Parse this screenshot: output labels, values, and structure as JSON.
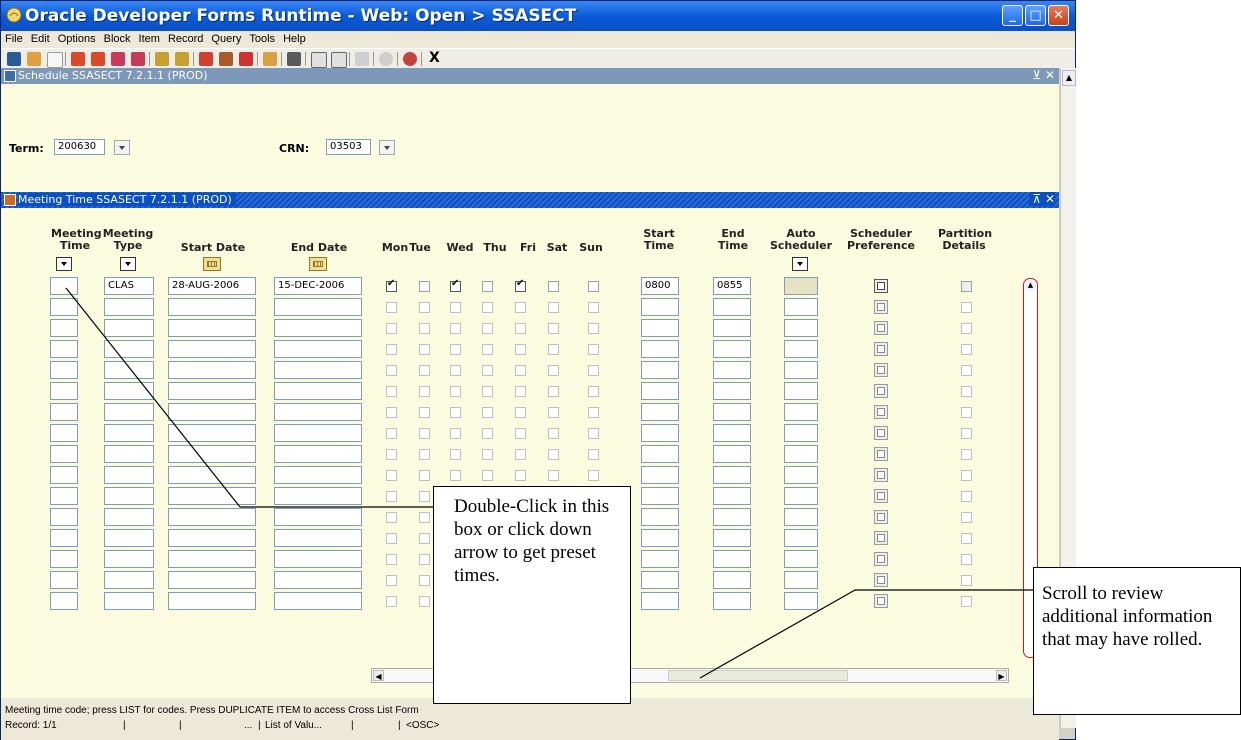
{
  "window": {
    "title": "Oracle Developer Forms Runtime - Web:  Open > SSASECT",
    "controls": [
      "minimize",
      "maximize",
      "close"
    ]
  },
  "menu": [
    "File",
    "Edit",
    "Options",
    "Block",
    "Item",
    "Record",
    "Query",
    "Tools",
    "Help"
  ],
  "toolbar": {
    "exit_label": "X",
    "icons": [
      "save-icon",
      "rollback-icon",
      "new-icon",
      "insert-record-icon",
      "remove-record-icon",
      "previous-block-icon",
      "next-block-icon",
      "enter-query-icon",
      "execute-query-icon",
      "options-icon",
      "db-icon",
      "delete-icon",
      "print-icon",
      "print2-icon",
      "x-icon",
      "x2-icon",
      "speaker-icon",
      "globe-icon",
      "help-icon"
    ]
  },
  "schedule_form": {
    "title": "Schedule  SSASECT  7.2.1.1  (PROD)",
    "term_label": "Term:",
    "term_value": "200630",
    "crn_label": "CRN:",
    "crn_value": "03503"
  },
  "meeting_block": {
    "title": "Meeting Time  SSASECT  7.2.1.1  (PROD)",
    "headers": {
      "meeting_time": "Meeting Time",
      "meeting_type": "Meeting Type",
      "start_date": "Start Date",
      "end_date": "End Date",
      "mon": "Mon",
      "tue": "Tue",
      "wed": "Wed",
      "thu": "Thu",
      "fri": "Fri",
      "sat": "Sat",
      "sun": "Sun",
      "start_time": "Start Time",
      "end_time": "End Time",
      "auto_scheduler": "Auto Scheduler",
      "scheduler_preference": "Scheduler Preference",
      "partition_details": "Partition Details"
    },
    "first_row": {
      "meeting_time": "",
      "meeting_type": "CLAS",
      "start_date": "28-AUG-2006",
      "end_date": "15-DEC-2006",
      "days_checked": [
        true,
        false,
        true,
        false,
        true,
        false,
        false
      ],
      "start_time": "0800",
      "end_time": "0855",
      "auto_scheduler": ""
    },
    "empty_rows": 15
  },
  "status": {
    "hint": "Meeting time code; press LIST for codes. Press DUPLICATE ITEM to access Cross List Form",
    "record": "Record: 1/1",
    "ellipsis": "...",
    "lov": "List of Valu...",
    "osc": "<OSC>"
  },
  "callouts": {
    "meeting_time_tip": "Double-Click in this box or click down arrow to get preset times.",
    "scroll_tip": "Scroll to review additional information that may have rolled."
  },
  "colors": {
    "title_bar": "#0a5bd8",
    "form_bg": "#fbfbe0",
    "block_title": "#0a4fc4",
    "schedule_title": "#7d98b8"
  }
}
